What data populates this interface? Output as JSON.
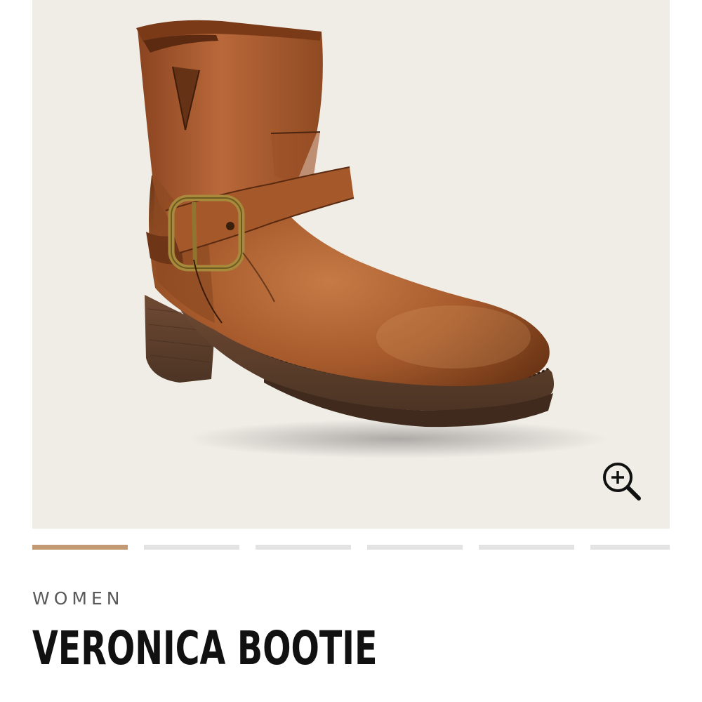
{
  "product": {
    "category": "WOMEN",
    "name": "VERONICA BOOTIE",
    "image_alt": "Veronica Bootie brown leather ankle boot with buckle strap"
  },
  "gallery": {
    "image_count": 6,
    "active_index": 0,
    "zoom_icon": "zoom-in-icon"
  },
  "colors": {
    "background": "#f0ede7",
    "active_indicator": "#c19a74",
    "inactive_indicator": "#e3e3e3",
    "title": "#111111",
    "category": "#5a5a5a"
  }
}
